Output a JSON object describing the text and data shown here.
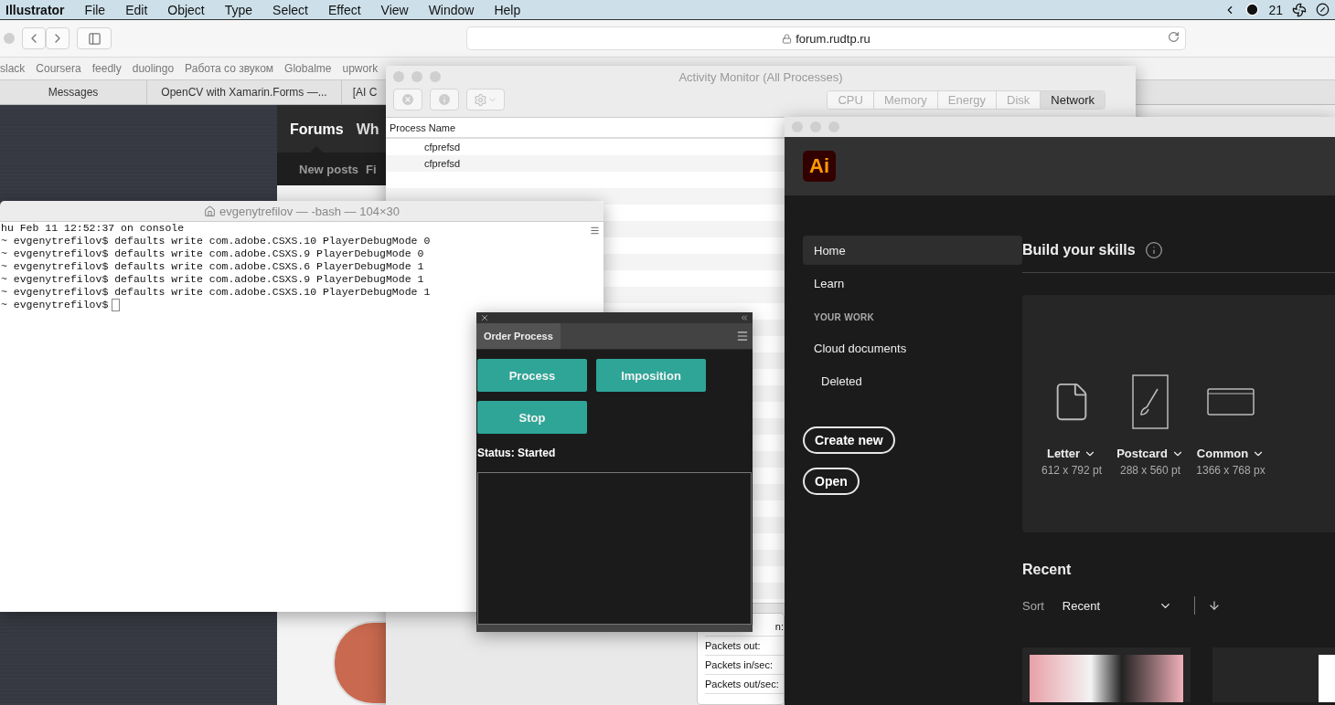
{
  "menu_bar": {
    "app": "Illustrator",
    "items": [
      "File",
      "Edit",
      "Object",
      "Type",
      "Select",
      "Effect",
      "View",
      "Window",
      "Help"
    ],
    "status_text": "21"
  },
  "browser": {
    "url": "forum.rudtp.ru",
    "bookmarks": [
      "slack",
      "Coursera",
      "feedly",
      "duolingo",
      "Работа со звуком",
      "Globalme",
      "upwork"
    ],
    "tabs": [
      "Messages",
      "OpenCV with Xamarin.Forms —...",
      "[AI C"
    ],
    "forum": {
      "nav": [
        {
          "label": "Forums",
          "selected": true
        },
        {
          "label": "Wh",
          "selected": false
        }
      ],
      "subnav": [
        "New posts",
        "Fi"
      ]
    }
  },
  "activity_monitor": {
    "title": "Activity Monitor (All Processes)",
    "tabs": [
      {
        "label": "CPU",
        "selected": false
      },
      {
        "label": "Memory",
        "selected": false
      },
      {
        "label": "Energy",
        "selected": false
      },
      {
        "label": "Disk",
        "selected": false
      },
      {
        "label": "Network",
        "selected": true
      }
    ],
    "columns": [
      "Process Name"
    ],
    "rows": [
      "cfprefsd",
      "cfprefsd"
    ],
    "stats": [
      "n:",
      "Packets out:",
      "Packets in/sec:",
      "Packets out/sec:"
    ]
  },
  "terminal": {
    "title": "evgenytrefilov — -bash — 104×30",
    "lines": [
      "hu Feb 11 12:52:37 on console",
      "~ evgenytrefilov$ defaults write com.adobe.CSXS.10 PlayerDebugMode 0",
      "~ evgenytrefilov$ defaults write com.adobe.CSXS.9 PlayerDebugMode 0",
      "~ evgenytrefilov$ defaults write com.adobe.CSXS.6 PlayerDebugMode 1",
      "~ evgenytrefilov$ defaults write com.adobe.CSXS.9 PlayerDebugMode 1",
      "~ evgenytrefilov$ defaults write com.adobe.CSXS.10 PlayerDebugMode 1",
      "~ evgenytrefilov$"
    ]
  },
  "panel": {
    "tab": "Order Process",
    "buttons": [
      "Process",
      "Imposition",
      "Stop"
    ],
    "status": "Status: Started"
  },
  "illustrator": {
    "logo": "Ai",
    "nav": [
      {
        "kind": "item",
        "label": "Home",
        "selected": true
      },
      {
        "kind": "item",
        "label": "Learn",
        "selected": false
      },
      {
        "kind": "heading",
        "label": "YOUR WORK"
      },
      {
        "kind": "item",
        "label": "Cloud documents",
        "selected": false
      },
      {
        "kind": "subitem",
        "label": "Deleted",
        "selected": false
      }
    ],
    "actions": [
      "Create new",
      "Open"
    ],
    "skills_title": "Build your skills",
    "presets": [
      {
        "kind": "letter",
        "name": "Letter",
        "size": "612 x 792 pt"
      },
      {
        "kind": "postcard",
        "name": "Postcard",
        "size": "288 x 560 pt"
      },
      {
        "kind": "web",
        "name": "Common",
        "size": "1366 x 768 px"
      }
    ],
    "recent_title": "Recent",
    "sort_label": "Sort",
    "sort_value": "Recent"
  }
}
